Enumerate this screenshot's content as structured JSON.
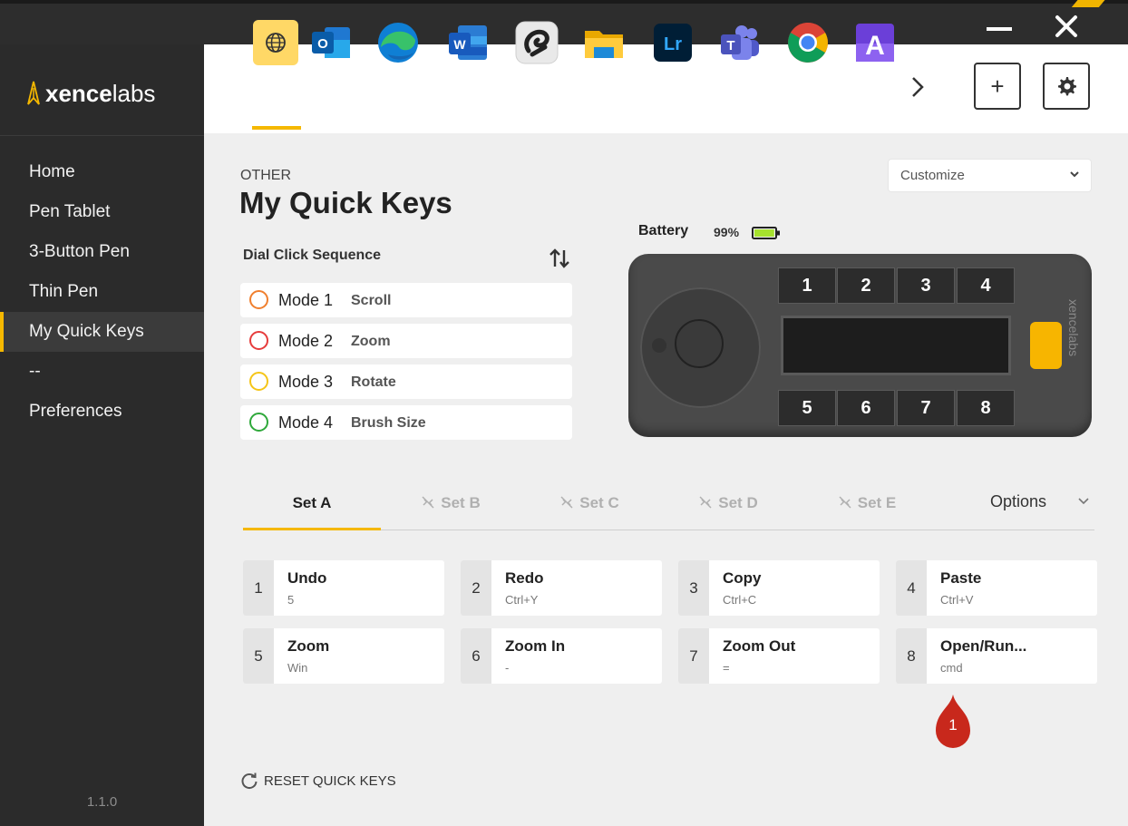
{
  "window": {
    "minimize_label": "—",
    "close_label": "✕"
  },
  "brand": {
    "part_bold": "xence",
    "part_light": "labs"
  },
  "sidebar": {
    "items": [
      {
        "label": "Home"
      },
      {
        "label": "Pen Tablet"
      },
      {
        "label": "3-Button Pen"
      },
      {
        "label": "Thin Pen"
      },
      {
        "label": "My Quick Keys",
        "active": true
      },
      {
        "label": "--"
      },
      {
        "label": "Preferences"
      }
    ],
    "version": "1.1.0"
  },
  "appbar": {
    "apps": [
      "globe-icon",
      "outlook-icon",
      "edge-icon",
      "word-icon",
      "clip-studio-icon",
      "file-explorer-icon",
      "lightroom-icon",
      "teams-icon",
      "chrome-icon",
      "affinity-icon"
    ],
    "selected_index": 0,
    "lightroom_label": "Lr",
    "affinity_label": "A",
    "outlook_label": "O",
    "word_label": "W",
    "teams_label": "T",
    "add_label": "+"
  },
  "header": {
    "subtitle": "OTHER",
    "title": "My Quick Keys",
    "customize": "Customize"
  },
  "dial": {
    "title": "Dial Click Sequence",
    "modes": [
      {
        "name": "Mode 1",
        "func": "Scroll",
        "color": "#f07f2e"
      },
      {
        "name": "Mode 2",
        "func": "Zoom",
        "color": "#e63c3c"
      },
      {
        "name": "Mode 3",
        "func": "Rotate",
        "color": "#f5c518"
      },
      {
        "name": "Mode 4",
        "func": "Brush Size",
        "color": "#2ea83a"
      }
    ]
  },
  "battery": {
    "label": "Battery",
    "value": "99%",
    "level": 0.99,
    "color": "#a6e22e"
  },
  "device": {
    "top_keys": [
      "1",
      "2",
      "3",
      "4"
    ],
    "bottom_keys": [
      "5",
      "6",
      "7",
      "8"
    ],
    "brand": "xencelabs"
  },
  "tabs": [
    {
      "label": "Set A",
      "active": true
    },
    {
      "label": "Set B"
    },
    {
      "label": "Set C"
    },
    {
      "label": "Set D"
    },
    {
      "label": "Set E"
    }
  ],
  "options_label": "Options",
  "keys": [
    {
      "num": "1",
      "name": "Undo",
      "shortcut": "5"
    },
    {
      "num": "2",
      "name": "Redo",
      "shortcut": "Ctrl+Y"
    },
    {
      "num": "3",
      "name": "Copy",
      "shortcut": "Ctrl+C"
    },
    {
      "num": "4",
      "name": "Paste",
      "shortcut": "Ctrl+V"
    },
    {
      "num": "5",
      "name": "Zoom",
      "shortcut": "Win"
    },
    {
      "num": "6",
      "name": "Zoom In",
      "shortcut": "-"
    },
    {
      "num": "7",
      "name": "Zoom Out",
      "shortcut": "="
    },
    {
      "num": "8",
      "name": "Open/Run...",
      "shortcut": "cmd"
    }
  ],
  "annotation": {
    "label": "1",
    "color": "#c8281c"
  },
  "reset_label": "RESET QUICK KEYS",
  "colors": {
    "accent": "#f5b800",
    "sidebar": "#2b2b2b",
    "main": "#efefef"
  }
}
